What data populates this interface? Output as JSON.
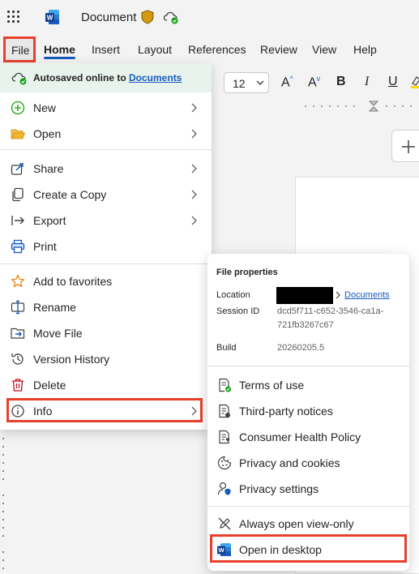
{
  "titlebar": {
    "app_icon": "word-icon",
    "document_title": "Document"
  },
  "tabs": [
    {
      "label": "File"
    },
    {
      "label": "Home"
    },
    {
      "label": "Insert"
    },
    {
      "label": "Layout"
    },
    {
      "label": "References"
    },
    {
      "label": "Review"
    },
    {
      "label": "View"
    },
    {
      "label": "Help"
    }
  ],
  "toolbar": {
    "font_size": "12",
    "grow_font": "A",
    "shrink_font": "A",
    "bold": "B",
    "italic": "I",
    "underline": "U"
  },
  "file_menu": {
    "autosave_text": "Autosaved online to ",
    "autosave_link": "Documents",
    "items": [
      {
        "label": "New",
        "icon": "plus-circle-icon"
      },
      {
        "label": "Open",
        "icon": "folder-open-icon"
      },
      {
        "label": "Share",
        "icon": "share-icon"
      },
      {
        "label": "Create a Copy",
        "icon": "copy-icon"
      },
      {
        "label": "Export",
        "icon": "export-icon"
      },
      {
        "label": "Print",
        "icon": "print-icon"
      },
      {
        "label": "Add to favorites",
        "icon": "star-icon"
      },
      {
        "label": "Rename",
        "icon": "rename-icon"
      },
      {
        "label": "Move File",
        "icon": "folder-move-icon"
      },
      {
        "label": "Version History",
        "icon": "history-icon"
      },
      {
        "label": "Delete",
        "icon": "trash-icon"
      },
      {
        "label": "Info",
        "icon": "info-icon"
      }
    ]
  },
  "info_panel": {
    "title": "File properties",
    "location_label": "Location",
    "location_link": "Documents",
    "session_label": "Session ID",
    "session_value_1": "dcd5f711-c652-3546-ca1a-",
    "session_value_2": "721fb3267c67",
    "build_label": "Build",
    "build_value": "20260205.5",
    "items": [
      {
        "label": "Terms of use",
        "icon": "terms-icon"
      },
      {
        "label": "Third-party notices",
        "icon": "notices-icon"
      },
      {
        "label": "Consumer Health Policy",
        "icon": "health-policy-icon"
      },
      {
        "label": "Privacy and cookies",
        "icon": "cookie-icon"
      },
      {
        "label": "Privacy settings",
        "icon": "privacy-settings-icon"
      },
      {
        "label": "Always open view-only",
        "icon": "edit-off-icon"
      },
      {
        "label": "Open in desktop",
        "icon": "word-icon"
      }
    ]
  },
  "colors": {
    "highlight": "#e8402c",
    "accent": "#185abd",
    "autosave_bg": "#e9f3ed"
  }
}
